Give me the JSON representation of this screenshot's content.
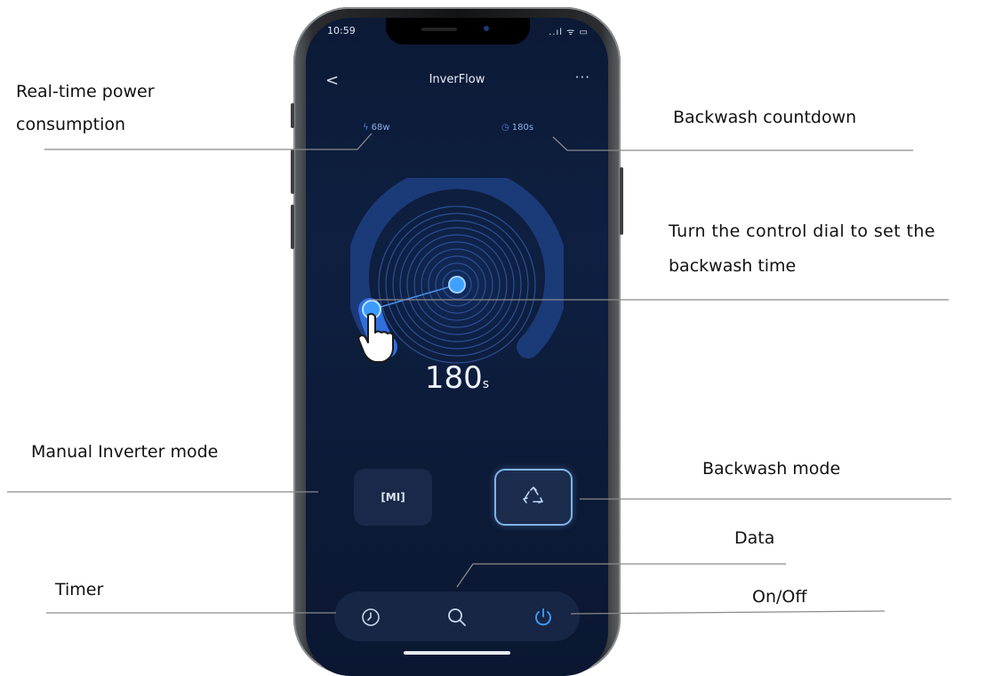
{
  "app": {
    "status_time": "10:59",
    "status_icons": "..ıl ᯤ ▭",
    "title": "InverFlow",
    "back_glyph": "<",
    "more_glyph": "···"
  },
  "readouts": {
    "power": "68w",
    "countdown": "180s"
  },
  "dial": {
    "value": "180",
    "unit": "s"
  },
  "modes": {
    "manual_label": "[MI]",
    "backwash_icon": "recycle-icon"
  },
  "bottom_bar": [
    "clock-icon",
    "search-icon",
    "power-icon"
  ],
  "callouts": {
    "power_line1": "Real-time  power",
    "power_line2": "consumption",
    "countdown": "Backwash countdown",
    "dial_line1": "Turn the control dial to set the",
    "dial_line2": "backwash time",
    "manual": "Manual Inverter mode",
    "backwash": "Backwash mode",
    "data": "Data",
    "timer": "Timer",
    "onoff": "On/Off"
  },
  "colors": {
    "screen_bg": "#0c1a36",
    "accent_blue": "#2f8dff",
    "selected_border": "#7fb2e8"
  }
}
